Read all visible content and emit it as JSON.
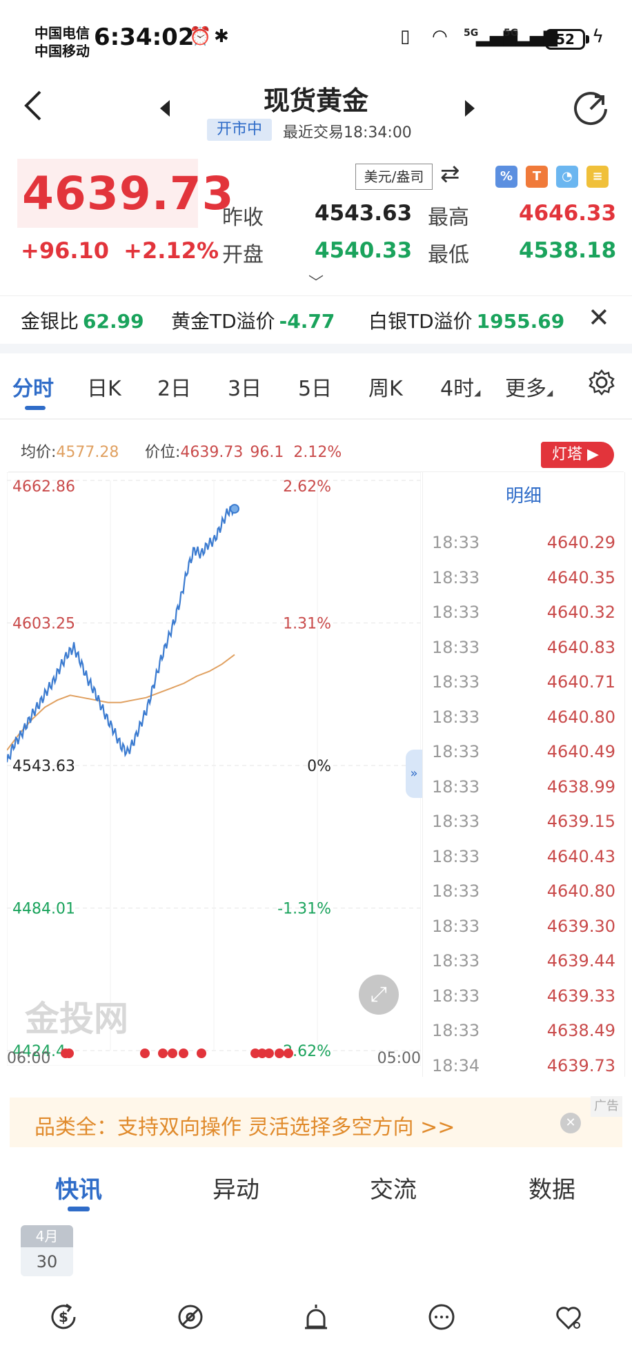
{
  "status": {
    "carrier1": "中国电信",
    "carrier2": "中国移动",
    "time": "6:34:02",
    "network1": "5G",
    "network2": "5G",
    "battery": "52"
  },
  "header": {
    "title": "现货黄金",
    "market_status": "开市中",
    "last_trade": "最近交易18:34:00"
  },
  "quote": {
    "price": "4639.73",
    "change": "+96.10",
    "change_pct": "+2.12%",
    "currency_unit": "美元/盎司",
    "prev_close_label": "昨收",
    "prev_close": "4543.63",
    "high_label": "最高",
    "high": "4646.33",
    "open_label": "开盘",
    "open": "4540.33",
    "low_label": "最低",
    "low": "4538.18"
  },
  "ratios": [
    {
      "label": "金银比",
      "value": "62.99"
    },
    {
      "label": "黄金TD溢价",
      "value": "-4.77"
    },
    {
      "label": "白银TD溢价",
      "value": "1955.69"
    }
  ],
  "tabs": [
    "分时",
    "日K",
    "2日",
    "3日",
    "5日",
    "周K",
    "4时",
    "更多"
  ],
  "info": {
    "avg_label": "均价:",
    "avg": "4577.28",
    "price_label": "价位:",
    "price": "4639.73",
    "change": "96.1",
    "change_pct": "2.12%",
    "lighthouse": "灯塔"
  },
  "chart_data": {
    "type": "line",
    "y_labels": [
      "4662.86",
      "4603.25",
      "4543.63",
      "4484.01",
      "4424.4"
    ],
    "pct_labels": [
      "2.62%",
      "1.31%",
      "0%",
      "-1.31%",
      "-2.62%"
    ],
    "x_labels": [
      "06:00",
      "05:00"
    ],
    "ylim": [
      4424.4,
      4662.86
    ],
    "series": [
      {
        "values": [
          4545,
          4552,
          4556,
          4561,
          4566,
          4570,
          4575,
          4579,
          4585,
          4590,
          4593,
          4587,
          4580,
          4575,
          4569,
          4563,
          4558,
          4552,
          4549,
          4554,
          4561,
          4568,
          4578,
          4588,
          4596,
          4604,
          4614,
          4626,
          4634,
          4632,
          4636,
          4638,
          4644,
          4650,
          4651
        ]
      },
      {
        "values": [
          4550,
          4557,
          4563,
          4568,
          4571,
          4573,
          4572,
          4571,
          4570,
          4570,
          4571,
          4572,
          4574,
          4576,
          4578,
          4581,
          4583,
          4586,
          4590
        ]
      }
    ]
  },
  "ticks": {
    "header": "明细",
    "rows": [
      {
        "time": "18:33",
        "price": "4640.29"
      },
      {
        "time": "18:33",
        "price": "4640.35"
      },
      {
        "time": "18:33",
        "price": "4640.32"
      },
      {
        "time": "18:33",
        "price": "4640.83"
      },
      {
        "time": "18:33",
        "price": "4640.71"
      },
      {
        "time": "18:33",
        "price": "4640.80"
      },
      {
        "time": "18:33",
        "price": "4640.49"
      },
      {
        "time": "18:33",
        "price": "4638.99"
      },
      {
        "time": "18:33",
        "price": "4639.15"
      },
      {
        "time": "18:33",
        "price": "4640.43"
      },
      {
        "time": "18:33",
        "price": "4640.80"
      },
      {
        "time": "18:33",
        "price": "4639.30"
      },
      {
        "time": "18:33",
        "price": "4639.44"
      },
      {
        "time": "18:33",
        "price": "4639.33"
      },
      {
        "time": "18:33",
        "price": "4638.49"
      },
      {
        "time": "18:34",
        "price": "4639.73"
      }
    ]
  },
  "watermark": "金投网",
  "ad": {
    "text": "品类全：支持双向操作 灵活选择多空方向 >>",
    "tag": "广告"
  },
  "news_tabs": [
    "快讯",
    "异动",
    "交流",
    "数据"
  ],
  "date_badge": {
    "month": "4月",
    "day": "30"
  },
  "colors": {
    "up": "#e2343b",
    "down": "#1aa35c",
    "accent": "#2f6cc8",
    "line": "#3b7bd0",
    "avg_line": "#e0a060"
  }
}
